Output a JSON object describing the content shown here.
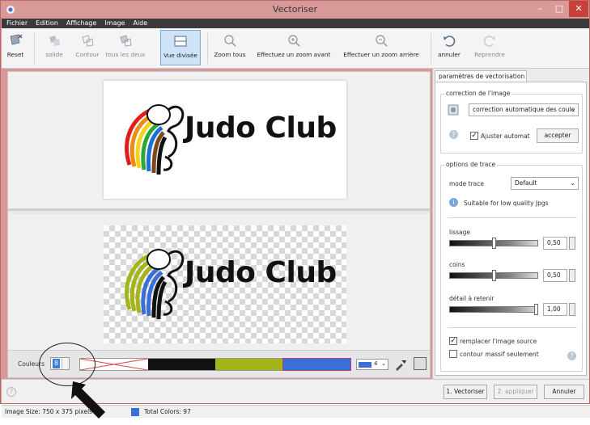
{
  "window": {
    "title": "Vectoriser"
  },
  "menu": [
    "Fichier",
    "Edition",
    "Affichage",
    "Image",
    "Aide"
  ],
  "toolbar": {
    "reset": "Reset",
    "solide": "solide",
    "contour": "Contour",
    "tous_deux": "tous les deux",
    "vue_divisee": "Vue divisée",
    "zoom_tous": "Zoom tous",
    "zoom_avant": "Effectuez un zoom avant",
    "zoom_arriere": "Effectuer un zoom arrière",
    "annuler": "annuler",
    "reprendre": "Reprendre"
  },
  "canvas": {
    "original_text": "Judo Club",
    "vector_text": "Judo Club"
  },
  "colorbar": {
    "label": "Couleurs",
    "count": "8",
    "swatches": [
      "#ffffff",
      "#111111",
      "#a3b51a",
      "#3a6fd8"
    ],
    "dropdown_value": "4",
    "dropdown_color": "#3a6fd8"
  },
  "panel": {
    "tab": "paramètres de vectorisation",
    "correction": {
      "title": "correction de l'image",
      "mode": "correction automatique des coule",
      "auto_label": "Ajuster automat",
      "auto_checked": true,
      "accept": "accepter"
    },
    "trace": {
      "title": "options de trace",
      "mode_label": "mode trace",
      "mode_value": "Default",
      "hint": "Suitable for low quality Jpgs",
      "lissage_label": "lissage",
      "lissage_value": "0,50",
      "coins_label": "coins",
      "coins_value": "0,50",
      "detail_label": "détail à retenir",
      "detail_value": "1,00",
      "replace_label": "remplacer l'image source",
      "replace_checked": true,
      "massive_label": "contour massif seulement",
      "massive_checked": false
    }
  },
  "buttons": {
    "vectoriser": "1. Vectoriser",
    "appliquer": "2. appliquer",
    "annuler": "Annuler"
  },
  "status": {
    "size": "Image Size: 750 x 375 pixels",
    "total": "Total Colors: 97",
    "color": "#3b6fd6"
  }
}
